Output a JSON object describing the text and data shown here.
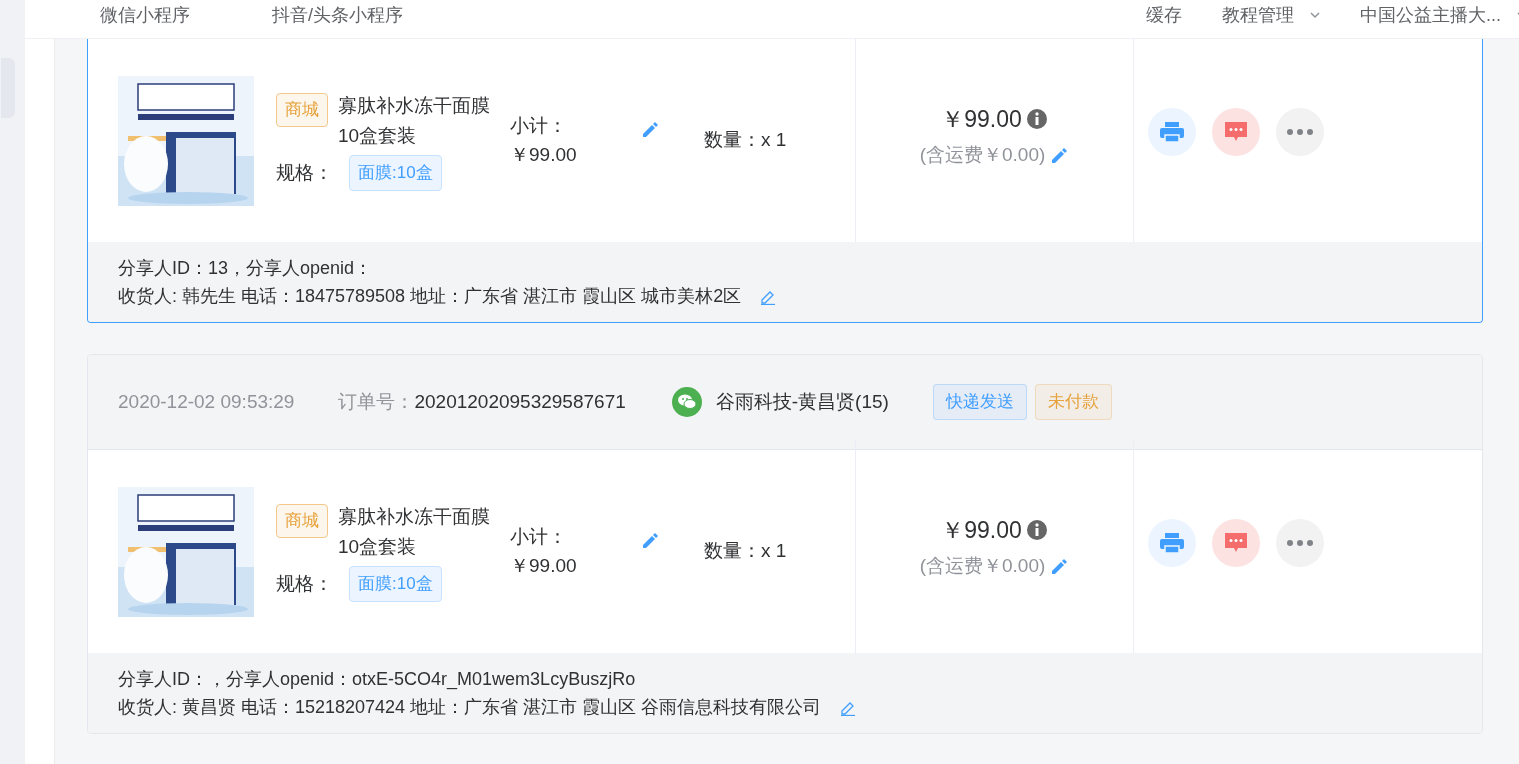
{
  "nav": {
    "left": [
      {
        "label": "微信小程序"
      },
      {
        "label": "抖音/头条小程序"
      }
    ],
    "right": [
      {
        "label": "缓存",
        "dropdown": false
      },
      {
        "label": "教程管理",
        "dropdown": true
      },
      {
        "label": "中国公益主播大...",
        "dropdown": true
      }
    ]
  },
  "orders": [
    {
      "selected": true,
      "items": [
        {
          "source_tag": "商城",
          "name": "寡肽补水冻干面膜10盒套装",
          "spec_label": "规格：",
          "spec": "面膜:10盒",
          "subtotal_label": "小计：",
          "subtotal": "￥99.00",
          "quantity": "数量：x 1"
        }
      ],
      "total": "￥99.00",
      "shipping": "(含运费￥0.00)",
      "sharer": "分享人ID：13，分享人openid：",
      "consignee": "收货人: 韩先生 电话：18475789508 地址：广东省 湛江市 霞山区 城市美林2区"
    },
    {
      "selected": false,
      "header": {
        "time": "2020-12-02 09:53:29",
        "order_no_label": "订单号：",
        "order_no": "20201202095329587671",
        "buyer": "谷雨科技-黄昌贤(15)",
        "tags": [
          {
            "label": "快递发送",
            "color": "#409eff"
          },
          {
            "label": "未付款",
            "color": "#e6a23c"
          }
        ]
      },
      "items": [
        {
          "source_tag": "商城",
          "name": "寡肽补水冻干面膜10盒套装",
          "spec_label": "规格：",
          "spec": "面膜:10盒",
          "subtotal_label": "小计：",
          "subtotal": "￥99.00",
          "quantity": "数量：x 1"
        }
      ],
      "total": "￥99.00",
      "shipping": "(含运费￥0.00)",
      "sharer": "分享人ID：，分享人openid：otxE-5CO4r_M01wem3LcyBuszjRo",
      "consignee": "收货人: 黄昌贤 电话：15218207424 地址：广东省 湛江市 霞山区 谷雨信息科技有限公司"
    }
  ]
}
